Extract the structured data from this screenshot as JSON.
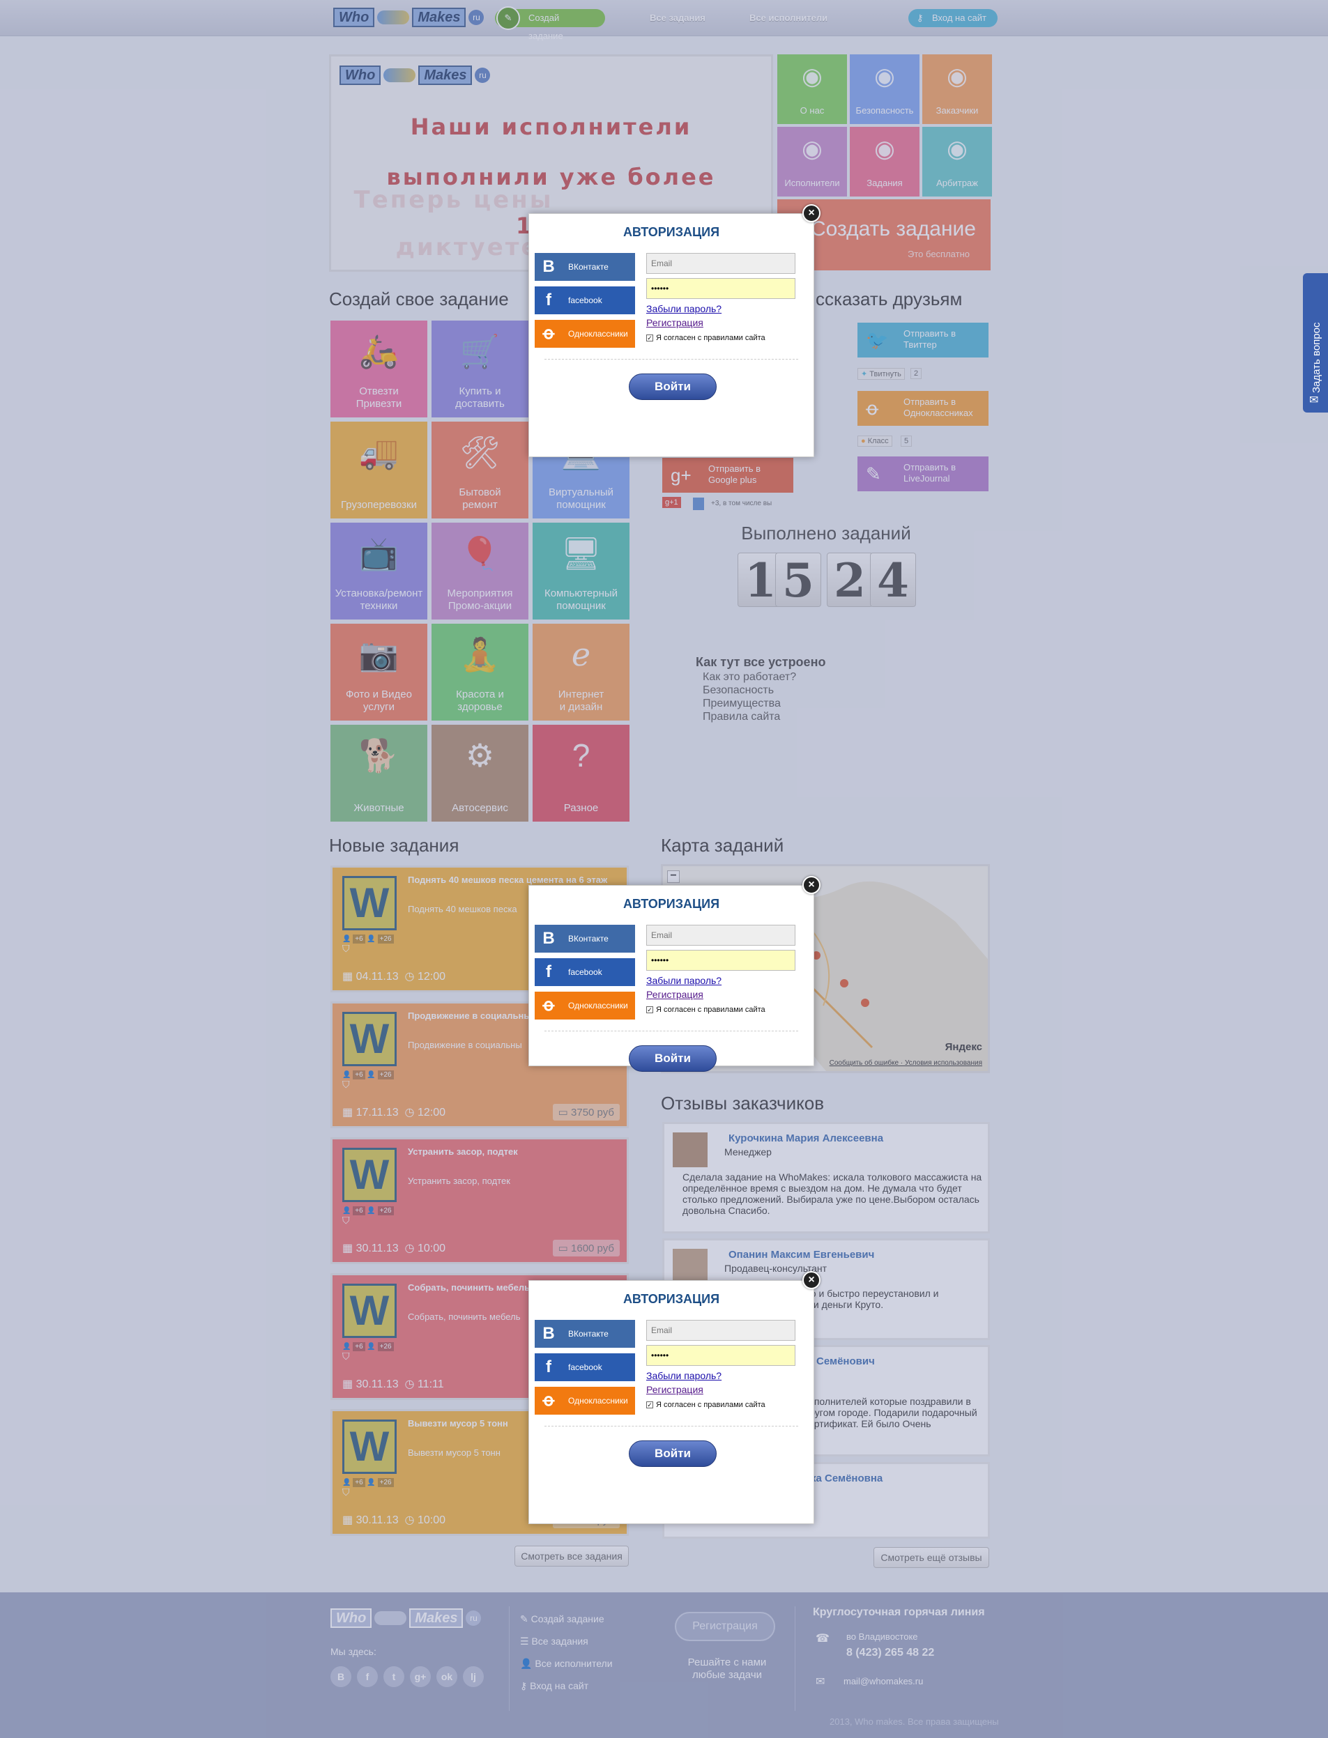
{
  "topbar": {
    "logo": {
      "who": "Who",
      "makes": "Makes",
      "ru": "ru"
    },
    "create_task": "Создай задание",
    "all_tasks": "Все задания",
    "all_performers": "Все исполнители",
    "login": "Вход на сайт"
  },
  "banner": {
    "line1": "Наши исполнители",
    "line2": "выполнили уже более",
    "line3": "1200",
    "ghost1": "Теперь цены",
    "ghost2": "диктуете"
  },
  "nav_tiles": [
    {
      "label": "О нас",
      "icon": "people-icon",
      "color": "#7fcf5a"
    },
    {
      "label": "Безопасность",
      "icon": "shield-dollar-icon",
      "color": "#7fa4ee"
    },
    {
      "label": "Заказчики",
      "icon": "person-icon",
      "color": "#f5a05a"
    },
    {
      "label": "Исполнители",
      "icon": "worker-icon",
      "color": "#c58ac8"
    },
    {
      "label": "Задания",
      "icon": "list-icon",
      "color": "#ee6f8f"
    },
    {
      "label": "Арбитраж",
      "icon": "scales-icon",
      "color": "#66c7c7"
    }
  ],
  "create_big": {
    "title": "Создать задание",
    "subtitle": "Это бесплатно"
  },
  "sections": {
    "create_own": "Создай свое задание",
    "tell_friends": "ссказать друзьям",
    "new_tasks": "Новые задания",
    "map": "Карта заданий",
    "reviews": "Отзывы заказчиков"
  },
  "categories": [
    {
      "label": "Отвезти\nПривезти",
      "icon": "scooter-icon",
      "color": "#ef6fa0"
    },
    {
      "label": "Купить и\nдоставить",
      "icon": "cart-icon",
      "color": "#8f86de"
    },
    {
      "label": "Грузоперевозки",
      "icon": "truck-icon",
      "color": "#f5b33a"
    },
    {
      "label": "Бытовой\nремонт",
      "icon": "tools-icon",
      "color": "#f07a5a"
    },
    {
      "label": "Виртуальный\nпомощник",
      "icon": "laptop-icon",
      "color": "#7fa4ee"
    },
    {
      "label": "Установка/ремонт\nтехники",
      "icon": "tv-icon",
      "color": "#8f86de"
    },
    {
      "label": "Мероприятия\nПромо-акции",
      "icon": "balloons-icon",
      "color": "#c58ac8"
    },
    {
      "label": "Компьютерный\nпомощник",
      "icon": "computer-icon",
      "color": "#4fc0b0"
    },
    {
      "label": "Фото и Видео\nуслуги",
      "icon": "camera-icon",
      "color": "#f07a5a"
    },
    {
      "label": "Красота и\nздоровье",
      "icon": "yoga-icon",
      "color": "#6fd06f"
    },
    {
      "label": "Интернет\nи дизайн",
      "icon": "ie-icon",
      "color": "#f5a05a"
    },
    {
      "label": "Животные",
      "icon": "animals-icon",
      "color": "#7fbf7f"
    },
    {
      "label": "Автосервис",
      "icon": "gear-truck-icon",
      "color": "#b08a6a"
    },
    {
      "label": "Разное",
      "icon": "question-icon",
      "color": "#e05060"
    }
  ],
  "share": {
    "twitter": "Отправить в\nТвиттер",
    "tweet": "Твитнуть",
    "tweet_count": "2",
    "ok": "Отправить в\nОдноклассниках",
    "klass": "Класс",
    "klass_count": "5",
    "gplus": "Отправить в\nGoogle plus",
    "gplus_badge": "g+1",
    "gplus_count": "+3, в том числе вы",
    "lj": "Отправить в\nLiveJournal"
  },
  "counter": {
    "title": "Выполнено заданий",
    "digits": [
      "1",
      "5",
      "2",
      "4"
    ]
  },
  "how": {
    "title": "Как тут все устроено",
    "links": [
      "Как это работает?",
      "Безопасность",
      "Преимущества",
      "Правила сайта"
    ]
  },
  "tasks": [
    {
      "title": "Поднять 40 мешков песка цемента на 6 этаж",
      "desc": "Поднять 40 мешков песка",
      "date": "04.11.13",
      "time": "12:00",
      "price": "",
      "color": "#f5b33a"
    },
    {
      "title": "Продвижение в социальных се",
      "desc": "Продвижение в социальны",
      "date": "17.11.13",
      "time": "12:00",
      "price": "3750 руб",
      "color": "#f5a05a"
    },
    {
      "title": "Устранить засор, подтек",
      "desc": "Устранить засор, подтек",
      "date": "30.11.13",
      "time": "10:00",
      "price": "1600 руб",
      "color": "#ef6f6f"
    },
    {
      "title": "Собрать, починить мебель",
      "desc": "Собрать, починить мебель",
      "date": "30.11.13",
      "time": "11:11",
      "price": "",
      "color": "#ef6f6f"
    },
    {
      "title": "Вывезти мусор 5 тонн",
      "desc": "Вывезти мусор 5 тонн",
      "date": "30.11.13",
      "time": "10:00",
      "price": "2450 руб",
      "color": "#f5b33a"
    }
  ],
  "task_badges": {
    "a": "+6",
    "b": "+26"
  },
  "see_all_tasks": "Смотреть все задания",
  "map_info": {
    "yandex": "Яндекс",
    "links": "Сообщить об ошибке · Условия использования"
  },
  "reviews": [
    {
      "name": "Курочкина Мария Алексеевна",
      "role": "Менеджер",
      "text": "Сделала задание на WhoMakes: искала толкового массажиста на определённое время с выездом на дом. Не думала что будет столько предложений. Выбирала уже по цене.Выбором осталась довольна Спасибо."
    },
    {
      "name": "Опанин Максим Евгеньевич",
      "role": "Продавец-консультант",
      "text": "Нашел того кто мне недорого и быстро переустановил и антивирус сэкономил время и деньги Круто."
    },
    {
      "name": "Семёнович",
      "role": "",
      "text": "исполнителей которые поздравили в другом городе. Подарили подарочный сертификат. Ей было Очень"
    },
    {
      "name": "ка Семёновна",
      "role": "",
      "text": ""
    }
  ],
  "see_more_reviews": "Смотреть ещё отзывы",
  "footer": {
    "here": "Мы здесь:",
    "links": [
      "Создай задание",
      "Все задания",
      "Все исполнители",
      "Вход на сайт"
    ],
    "register": "Регистрация",
    "slogan": "Решайте с нами\nлюбые задачи",
    "hotline": "Круглосуточная горячая линия",
    "city": "во Владивостоке",
    "phone": "8 (423) 265 48 22",
    "email": "mail@whomakes.ru",
    "copyright": "2013, Who makes. Все права защищены",
    "socials": [
      "В",
      "f",
      "t",
      "g+",
      "ok",
      "lj"
    ]
  },
  "sidetab": "Задать вопрос",
  "modal": {
    "title": "АВТОРИЗАЦИЯ",
    "vk": "ВКонтакте",
    "fb": "facebook",
    "ok": "Одноклассники",
    "email_placeholder": "Email",
    "password_value": "••••••",
    "forgot": "Забыли пароль?",
    "register": "Регистрация",
    "agree": "Я согласен с правилами сайта",
    "login": "Войти"
  }
}
